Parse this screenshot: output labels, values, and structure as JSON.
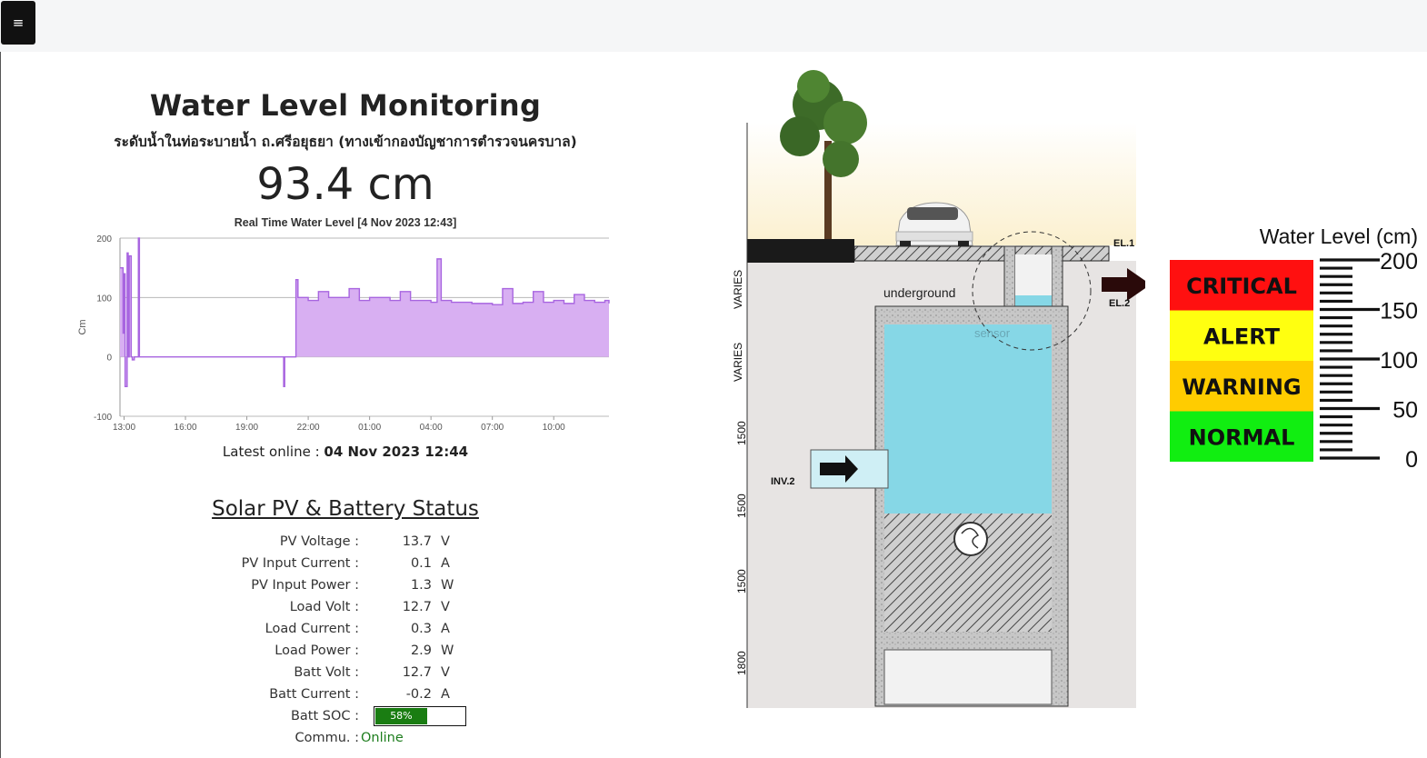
{
  "menu": {
    "icon": "hamburger-icon",
    "glyph": "≡"
  },
  "header": {
    "title": "Water Level Monitoring",
    "subtitle": "ระดับน้ำในท่อระบายน้ำ ถ.ศรีอยุธยา (ทางเข้ากองบัญชาการตำรวจนครบาล)"
  },
  "current_level": "93.4 cm",
  "chart_data": {
    "type": "area",
    "title": "Real Time Water Level [4 Nov 2023 12:43]",
    "xlabel": "",
    "ylabel": "Cm",
    "ylim": [
      -100,
      200
    ],
    "yticks": [
      "200",
      "100",
      "0",
      "-100"
    ],
    "xticks": [
      "13:00",
      "16:00",
      "19:00",
      "22:00",
      "01:00",
      "04:00",
      "07:00",
      "10:00"
    ],
    "x_hours": [
      12.8,
      12.95,
      13.0,
      13.05,
      13.15,
      13.2,
      13.25,
      13.35,
      13.4,
      13.5,
      13.7,
      13.75,
      13.8,
      14.0,
      16.0,
      19.0,
      20.5,
      20.8,
      20.85,
      21.3,
      21.4,
      21.5,
      22.0,
      22.5,
      23.0,
      23.5,
      24.0,
      24.5,
      25.0,
      25.5,
      26.0,
      26.5,
      27.0,
      27.5,
      28.0,
      28.3,
      28.5,
      29.0,
      30.0,
      30.5,
      31.0,
      31.5,
      32.0,
      32.5,
      33.0,
      33.5,
      34.0,
      34.5,
      35.0,
      35.5,
      36.0,
      36.5,
      36.7
    ],
    "values": [
      150,
      40,
      140,
      -50,
      175,
      0,
      170,
      0,
      -5,
      0,
      200,
      0,
      0,
      0,
      0,
      0,
      0,
      -50,
      0,
      0,
      130,
      100,
      95,
      110,
      100,
      100,
      115,
      95,
      100,
      100,
      95,
      110,
      95,
      95,
      92,
      165,
      95,
      92,
      90,
      90,
      88,
      115,
      90,
      92,
      110,
      92,
      95,
      90,
      105,
      95,
      92,
      95,
      90
    ]
  },
  "latest_online": {
    "label": "Latest online :",
    "value": "04 Nov 2023 12:44"
  },
  "solar": {
    "title": "Solar PV & Battery Status",
    "rows": [
      {
        "label": "PV Voltage :",
        "value": "13.7",
        "unit": "V"
      },
      {
        "label": "PV Input Current :",
        "value": "0.1",
        "unit": "A"
      },
      {
        "label": "PV Input Power :",
        "value": "1.3",
        "unit": "W"
      },
      {
        "label": "Load Volt :",
        "value": "12.7",
        "unit": "V"
      },
      {
        "label": "Load Current :",
        "value": "0.3",
        "unit": "A"
      },
      {
        "label": "Load Power :",
        "value": "2.9",
        "unit": "W"
      },
      {
        "label": "Batt Volt :",
        "value": "12.7",
        "unit": "V"
      },
      {
        "label": "Batt Current :",
        "value": "-0.2",
        "unit": "A"
      }
    ],
    "soc_label": "Batt SOC :",
    "soc_value": 58,
    "soc_text": "58%",
    "comm_label": "Commu. :",
    "comm_value": "Online"
  },
  "diagram": {
    "labels": {
      "el1": "EL.1",
      "el2": "EL.2",
      "inv2": "INV.2",
      "underground": "underground",
      "sensor": "sensor",
      "varies1": "VARIES",
      "varies2": "VARIES",
      "dim1": "1500",
      "dim2": "1500",
      "dim3": "1500",
      "dim4": "1800"
    }
  },
  "legend": {
    "title": "Water Level (cm)",
    "levels": [
      {
        "name": "CRITICAL",
        "color": "#ff1010"
      },
      {
        "name": "ALERT",
        "color": "#ffff10"
      },
      {
        "name": "WARNING",
        "color": "#ffcc00"
      },
      {
        "name": "NORMAL",
        "color": "#11ee11"
      }
    ],
    "scale": [
      "200",
      "150",
      "100",
      "50",
      "0"
    ]
  },
  "colors": {
    "chart_fill": "#d8aff2",
    "chart_line": "#a865e0",
    "water": "#86d7e6",
    "soc": "#1a7d12",
    "online": "#1e7e1e"
  }
}
